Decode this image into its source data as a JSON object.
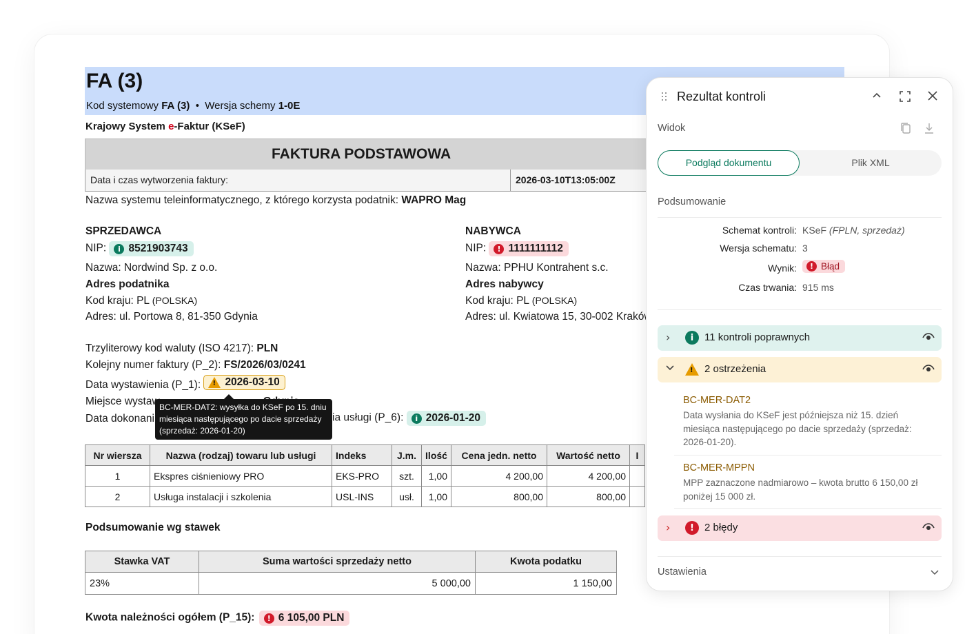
{
  "document": {
    "title": "FA (3)",
    "sub_kod_label": "Kod systemowy",
    "sub_kod_value": "FA (3)",
    "sub_bullet": "•",
    "sub_wersja_label": "Wersja schemy",
    "sub_wersja_value": "1-0E",
    "ksef_pre": "Krajowy System ",
    "ksef_red": "e",
    "ksef_post": "-Faktur (KSeF)",
    "faktura_heading": "FAKTURA PODSTAWOWA",
    "date_label": "Data i czas wytworzenia faktury:",
    "date_value": "2026-03-10T13:05:00Z",
    "system_label": "Nazwa systemu teleinformatycznego, z którego korzysta podatnik:",
    "system_value": "WAPRO Mag",
    "seller": {
      "heading": "SPRZEDAWCA",
      "nip_label": "NIP:",
      "nip_value": "8521903743",
      "name_line": "Nazwa: Nordwind Sp. z o.o.",
      "addr_heading": "Adres podatnika",
      "country_label": "Kod kraju: PL",
      "country_paren": "(POLSKA)",
      "address": "Adres: ul. Portowa 8, 81-350 Gdynia"
    },
    "buyer": {
      "heading": "NABYWCA",
      "nip_label": "NIP:",
      "nip_value": "1111111112",
      "name_line": "Nazwa: PPHU Kontrahent s.c.",
      "addr_heading": "Adres nabywcy",
      "country_label": "Kod kraju: PL",
      "country_paren": "(POLSKA)",
      "address": "Adres: ul. Kwiatowa 15, 30-002 Kraków"
    },
    "currency_label": "Trzyliterowy kod waluty (ISO 4217):",
    "currency_value": "PLN",
    "invoice_no_label": "Kolejny numer faktury (P_2):",
    "invoice_no_value": "FS/2026/03/0241",
    "issue_date_label": "Data wystawienia (P_1):",
    "issue_date_value": "2026-03-10",
    "place_label_partial": "Miejsce wystaw",
    "place_value_partial": "Gdynia",
    "sale_label_left": "Data dokonani",
    "sale_label_right": "ia usługi (P_6):",
    "sale_date_value": "2026-01-20",
    "tooltip": "BC-MER-DAT2: wysyłka do KSeF po 15. dniu miesiąca następującego po dacie sprzedaży (sprzedaż: 2026-01-20)",
    "items_table": {
      "headers": [
        "Nr wiersza",
        "Nazwa (rodzaj) towaru lub usługi",
        "Indeks",
        "J.m.",
        "Ilość",
        "Cena jedn. netto",
        "Wartość netto",
        "I"
      ],
      "rows": [
        [
          "1",
          "Ekspres ciśnieniowy PRO",
          "EKS-PRO",
          "szt.",
          "1,00",
          "4 200,00",
          "4 200,00",
          ""
        ],
        [
          "2",
          "Usługa instalacji i szkolenia",
          "USL-INS",
          "usł.",
          "1,00",
          "800,00",
          "800,00",
          ""
        ]
      ]
    },
    "summary_title": "Podsumowanie wg stawek",
    "vat_table": {
      "headers": [
        "Stawka VAT",
        "Suma wartości sprzedaży netto",
        "Kwota podatku"
      ],
      "rows": [
        [
          "23%",
          "5 000,00",
          "1 150,00"
        ]
      ]
    },
    "total_label": "Kwota należności ogółem (P_15):",
    "total_value": "6 105,00 PLN"
  },
  "panel": {
    "title": "Rezultat kontroli",
    "view_label": "Widok",
    "tabs": [
      "Podgląd dokumentu",
      "Plik XML"
    ],
    "summary_heading": "Podsumowanie",
    "schema_label": "Schemat kontroli:",
    "schema_value": "KSeF",
    "schema_paren": "(FPLN, sprzedaż)",
    "version_label": "Wersja schematu:",
    "version_value": "3",
    "result_label": "Wynik:",
    "result_value": "Błąd",
    "duration_label": "Czas trwania:",
    "duration_value": "915 ms",
    "groups": {
      "ok_label": "11 kontroli poprawnych",
      "warn_label": "2 ostrzeżenia",
      "err_label": "2 błędy"
    },
    "warnings": [
      {
        "code": "BC-MER-DAT2",
        "desc": "Data wysłania do KSeF jest późniejsza niż 15. dzień miesiąca następującego po dacie sprzedaży (sprzedaż: 2026-01-20)."
      },
      {
        "code": "BC-MER-MPPN",
        "desc": "MPP zaznaczone nadmiarowo – kwota brutto 6 150,00 zł poniżej 15 000 zł."
      }
    ],
    "settings_label": "Ustawienia"
  },
  "colors": {
    "header_band": "#c9dcfb",
    "ok": "#0b7a5e",
    "error": "#d11a2a",
    "warning": "#e69b00"
  }
}
